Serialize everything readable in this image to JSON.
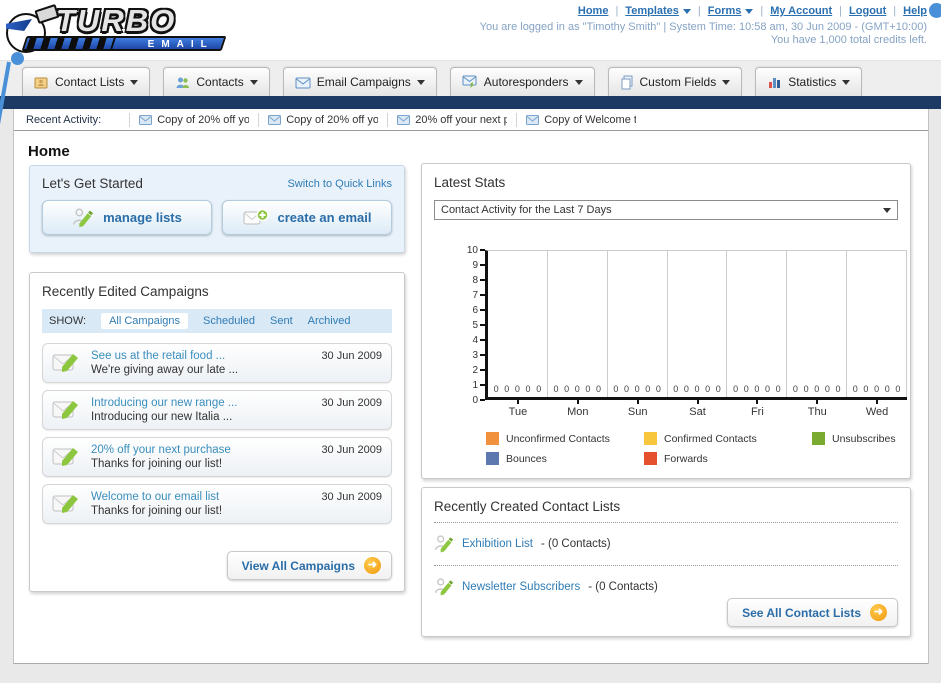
{
  "header": {
    "logo": {
      "title": "TURBO",
      "subtitle": "EMAIL"
    },
    "nav": [
      {
        "label": "Home",
        "dropdown": false
      },
      {
        "label": "Templates",
        "dropdown": true
      },
      {
        "label": "Forms",
        "dropdown": true
      },
      {
        "label": "My Account",
        "dropdown": false
      },
      {
        "label": "Logout",
        "dropdown": false
      },
      {
        "label": "Help",
        "dropdown": false
      }
    ],
    "status_line": "You are logged in as \"Timothy Smith\" | System Time: 10:58 am, 30 Jun 2009 - (GMT+10:00)",
    "credits_line": "You have 1,000 total credits left."
  },
  "tabs": [
    {
      "label": "Contact Lists",
      "icon": "contact-lists-icon"
    },
    {
      "label": "Contacts",
      "icon": "contacts-icon"
    },
    {
      "label": "Email Campaigns",
      "icon": "email-campaigns-icon"
    },
    {
      "label": "Autoresponders",
      "icon": "autoresponders-icon"
    },
    {
      "label": "Custom Fields",
      "icon": "custom-fields-icon"
    },
    {
      "label": "Statistics",
      "icon": "statistics-icon"
    }
  ],
  "recent_activity": {
    "label": "Recent Activity:",
    "items": [
      "Copy of 20% off yo",
      "Copy of 20% off yo",
      "20% off your next p",
      "Copy of Welcome to"
    ]
  },
  "page_title": "Home",
  "get_started": {
    "title": "Let's Get Started",
    "switch_link": "Switch to Quick Links",
    "buttons": [
      {
        "label": "manage lists",
        "icon": "list-pencil-icon"
      },
      {
        "label": "create an email",
        "icon": "email-plus-icon"
      }
    ]
  },
  "campaigns": {
    "title": "Recently Edited Campaigns",
    "show_label": "SHOW:",
    "filters": [
      {
        "label": "All Campaigns",
        "active": true
      },
      {
        "label": "Scheduled",
        "active": false
      },
      {
        "label": "Sent",
        "active": false
      },
      {
        "label": "Archived",
        "active": false
      }
    ],
    "items": [
      {
        "title": "See us at the retail food ...",
        "desc": "We're giving away our late ...",
        "date": "30 Jun 2009"
      },
      {
        "title": "Introducing our new range ...",
        "desc": "Introducing our new Italia ...",
        "date": "30 Jun 2009"
      },
      {
        "title": "20% off your next purchase",
        "desc": "Thanks for joining our list!",
        "date": "30 Jun 2009"
      },
      {
        "title": "Welcome to our email list",
        "desc": "Thanks for joining our list!",
        "date": "30 Jun 2009"
      }
    ],
    "view_all_label": "View All Campaigns"
  },
  "stats": {
    "title": "Latest Stats",
    "selected_option": "Contact Activity for the Last 7 Days"
  },
  "chart_data": {
    "type": "bar",
    "title": "Contact Activity for the Last 7 Days",
    "categories": [
      "Tue",
      "Mon",
      "Sun",
      "Sat",
      "Fri",
      "Thu",
      "Wed"
    ],
    "series": [
      {
        "name": "Unconfirmed Contacts",
        "color": "#f2913d",
        "values": [
          0,
          0,
          0,
          0,
          0,
          0,
          0
        ]
      },
      {
        "name": "Confirmed Contacts",
        "color": "#f8c63c",
        "values": [
          0,
          0,
          0,
          0,
          0,
          0,
          0
        ]
      },
      {
        "name": "Unsubscribes",
        "color": "#7aab30",
        "values": [
          0,
          0,
          0,
          0,
          0,
          0,
          0
        ]
      },
      {
        "name": "Bounces",
        "color": "#5d78ae",
        "values": [
          0,
          0,
          0,
          0,
          0,
          0,
          0
        ]
      },
      {
        "name": "Forwards",
        "color": "#e5512d",
        "values": [
          0,
          0,
          0,
          0,
          0,
          0,
          0
        ]
      }
    ],
    "ylim": [
      0,
      10
    ],
    "ytick_step": 1,
    "grid": true,
    "legend_position": "bottom"
  },
  "contact_lists": {
    "title": "Recently Created Contact Lists",
    "items": [
      {
        "name": "Exhibition List",
        "suffix": " - (0 Contacts)"
      },
      {
        "name": "Newsletter Subscribers",
        "suffix": " - (0 Contacts)"
      }
    ],
    "see_all_label": "See All Contact Lists"
  },
  "colors": {
    "navy_bar": "#1c3a63",
    "link": "#2f7cb5",
    "accent_orange": "#f5a81c"
  }
}
